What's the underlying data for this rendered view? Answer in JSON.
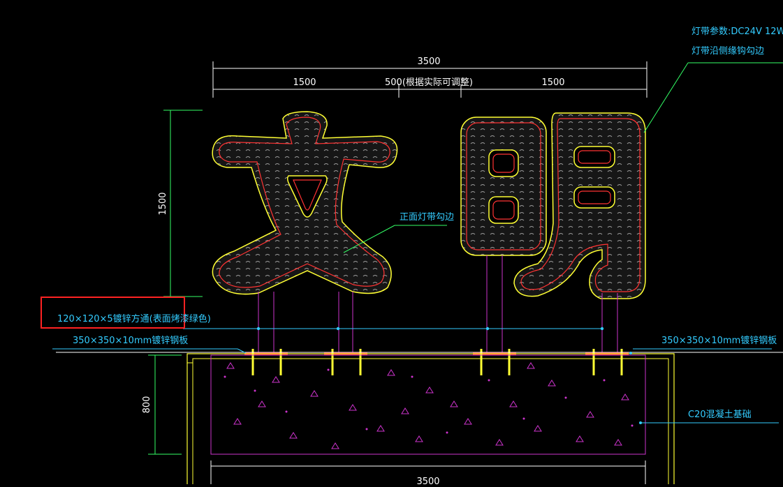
{
  "signage": {
    "characters": [
      "文",
      "明"
    ]
  },
  "dimensions": {
    "overall_width_top": "3500",
    "segment_left": "1500",
    "segment_middle": "500(根据实际可调整)",
    "segment_right": "1500",
    "height_characters": "1500",
    "foundation_depth": "800",
    "overall_width_bottom": "3500"
  },
  "annotations": {
    "led_params": "灯带参数:DC24V  12W",
    "led_side": "灯带沿侧缘钩勾边",
    "front_led": "正面灯带勾边",
    "tube_spec": "120×120×5镀锌方通(表面烤漆绿色)",
    "plate_left": "350×350×10mm镀锌钢板",
    "plate_right": "350×350×10mm镀锌钢板",
    "concrete": "C20混凝土基础"
  },
  "colors": {
    "background": "#000000",
    "dimension_line": "#ffffff",
    "outline_yellow": "#ffff33",
    "outline_red": "#ff3333",
    "leader_green": "#33ff66",
    "leader_cyan": "#33ccff",
    "foundation_magenta": "#cc33cc",
    "plate_red": "#ff2222",
    "highlight_box": "#ff2222"
  }
}
